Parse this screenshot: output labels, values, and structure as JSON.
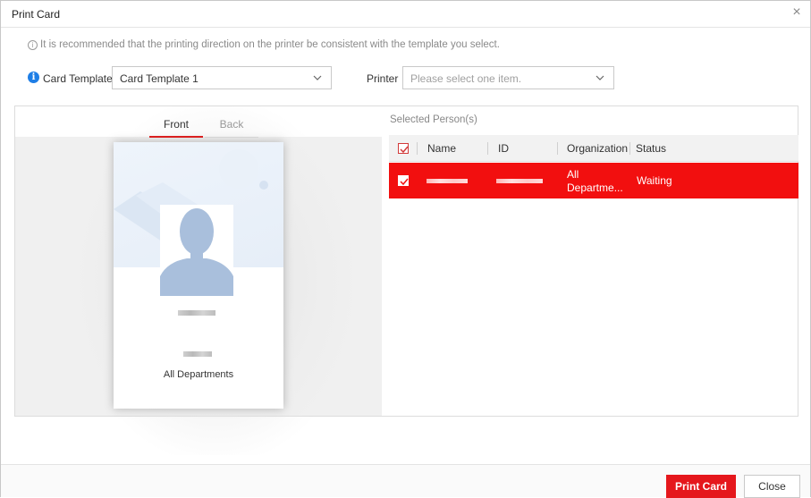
{
  "dialog": {
    "title": "Print Card",
    "close_symbol": "×"
  },
  "hint": {
    "icon": "info-outline-icon",
    "text": "It is recommended that the printing direction on the printer be consistent with the template you select."
  },
  "form": {
    "card_template_label": "Card Template",
    "card_template_value": "Card Template 1",
    "printer_label": "Printer",
    "printer_placeholder": "Please select one item."
  },
  "preview": {
    "tabs": [
      "Front",
      "Back"
    ],
    "active_tab": "Front",
    "card": {
      "department": "All Departments"
    }
  },
  "selected": {
    "title": "Selected Person(s)",
    "columns": [
      "Name",
      "ID",
      "Organization",
      "Status"
    ],
    "rows": [
      {
        "organization_line1": "All",
        "organization_line2": "Departme...",
        "status": "Waiting",
        "checked": true
      }
    ]
  },
  "footer": {
    "print_label": "Print Card",
    "close_label": "Close"
  },
  "colors": {
    "accent": "#e5171c",
    "row_selected": "#f20f0f",
    "info_blue": "#1e7ee6"
  }
}
